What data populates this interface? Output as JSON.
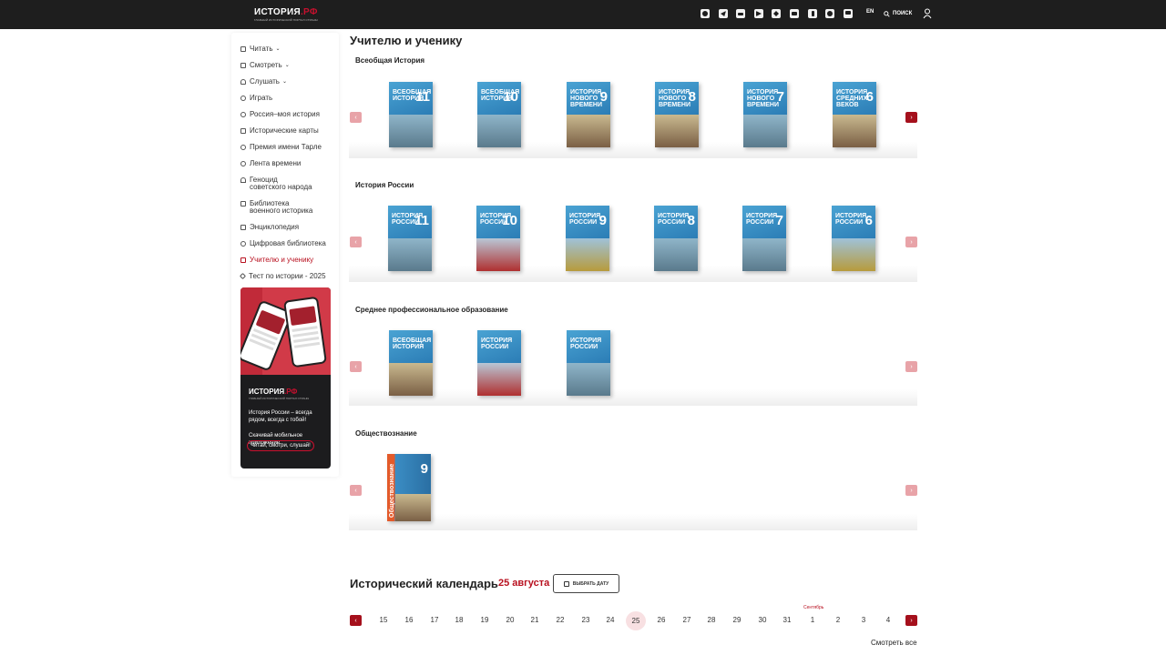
{
  "header": {
    "logo_main": "ИСТОРИЯ",
    "logo_rf": ".РФ",
    "logo_sub": "ГЛАВНЫЙ ИСТОРИЧЕСКИЙ ПОРТАЛ СТРАНЫ",
    "social_icons": [
      "max-icon",
      "telegram-icon",
      "vk-icon",
      "rutube-icon",
      "dzen-icon",
      "youtube-icon",
      "odnoklassniki-icon",
      "ok-video-icon",
      "tv-icon"
    ],
    "lang": "EN",
    "search_label": "ПОИСК"
  },
  "sidebar": {
    "items": [
      {
        "label": "Читать",
        "chevron": "⌄"
      },
      {
        "label": "Смотреть",
        "chevron": "⌄"
      },
      {
        "label": "Слушать",
        "chevron": "⌄"
      },
      {
        "label": "Играть"
      },
      {
        "label": "Россия–моя история"
      },
      {
        "label": "Исторические карты"
      },
      {
        "label": "Премия имени Тарле"
      },
      {
        "label": "Лента времени"
      },
      {
        "label": "Геноцид советского народа"
      },
      {
        "label": "Библиотека военного историка"
      },
      {
        "label": "Энциклопедия"
      },
      {
        "label": "Цифровая библиотека"
      },
      {
        "label": "Учителю и ученику"
      },
      {
        "label": "Тест по истории - 2025"
      }
    ],
    "active_index": 12,
    "accent_color": "#b8101f",
    "promo": {
      "logo_main": "ИСТОРИЯ",
      "logo_rf": ".РФ",
      "logo_sub": "ГЛАВНЫЙ ИСТОРИЧЕСКИЙ ПОРТАЛ СТРАНЫ",
      "text1": "История России – всегда рядом, всегда с тобой!",
      "text2": "Скачивай мобильное приложение.",
      "pill": "Читай, смотри, слушай!"
    }
  },
  "main": {
    "title": "Учителю и ученику",
    "sections": [
      {
        "title": "Всеобщая История",
        "books": [
          {
            "title": "Всеобщая история",
            "grade": "11"
          },
          {
            "title": "Всеобщая история",
            "grade": "10"
          },
          {
            "title": "История нового времени",
            "grade": "9"
          },
          {
            "title": "История нового времени",
            "grade": "8"
          },
          {
            "title": "История нового времени",
            "grade": "7"
          },
          {
            "title": "История средних веков",
            "grade": "6"
          }
        ]
      },
      {
        "title": "История России",
        "books": [
          {
            "title": "История России",
            "grade": "11"
          },
          {
            "title": "История России",
            "grade": "10"
          },
          {
            "title": "История России",
            "grade": "9"
          },
          {
            "title": "История России",
            "grade": "8"
          },
          {
            "title": "История России",
            "grade": "7"
          },
          {
            "title": "История России",
            "grade": "6"
          }
        ]
      },
      {
        "title": "Среднее профессиональное образование",
        "books": [
          {
            "title": "Всеобщая история",
            "grade": ""
          },
          {
            "title": "История России",
            "grade": ""
          },
          {
            "title": "История России",
            "grade": ""
          }
        ]
      },
      {
        "title": "Обществознание",
        "books": [
          {
            "title": "Обществознание",
            "grade": "9"
          }
        ]
      }
    ]
  },
  "calendar": {
    "title": "Исторический календарь",
    "date": "25 августа",
    "choose_date": "ВЫБРАТЬ ДАТУ",
    "days": [
      "15",
      "16",
      "17",
      "18",
      "19",
      "20",
      "21",
      "22",
      "23",
      "24",
      "25",
      "26",
      "27",
      "28",
      "29",
      "30",
      "31",
      "1",
      "2",
      "3",
      "4"
    ],
    "selected_day": "25",
    "month_label": "Сентябрь",
    "see_all": "Смотреть все"
  }
}
